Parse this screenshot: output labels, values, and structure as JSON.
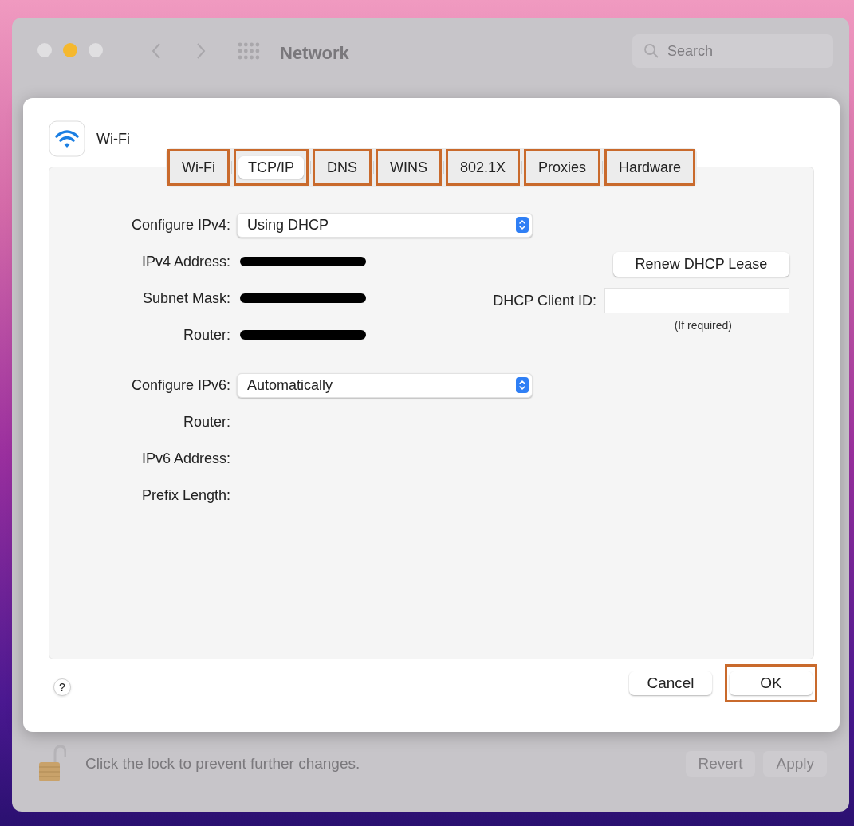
{
  "window": {
    "title": "Network",
    "search": {
      "placeholder": "Search"
    }
  },
  "sheet": {
    "title": "Wi-Fi",
    "tabs": [
      {
        "label": "Wi-Fi",
        "selected": false,
        "highlighted": true
      },
      {
        "label": "TCP/IP",
        "selected": true,
        "highlighted": true
      },
      {
        "label": "DNS",
        "selected": false,
        "highlighted": true
      },
      {
        "label": "WINS",
        "selected": false,
        "highlighted": true
      },
      {
        "label": "802.1X",
        "selected": false,
        "highlighted": true
      },
      {
        "label": "Proxies",
        "selected": false,
        "highlighted": true
      },
      {
        "label": "Hardware",
        "selected": false,
        "highlighted": true
      }
    ],
    "ipv4": {
      "label": "Configure IPv4:",
      "value": "Using DHCP"
    },
    "ipv4_fields": [
      {
        "label": "IPv4 Address:",
        "redacted": true
      },
      {
        "label": "Subnet Mask:",
        "redacted": true
      },
      {
        "label": "Router:",
        "redacted": true
      }
    ],
    "renew_button": "Renew DHCP Lease",
    "client_id": {
      "label": "DHCP Client ID:",
      "hint": "(If required)"
    },
    "ipv6": {
      "label": "Configure IPv6:",
      "value": "Automatically"
    },
    "ipv6_fields": [
      {
        "label": "Router:",
        "redacted": false
      },
      {
        "label": "IPv6 Address:",
        "redacted": false
      },
      {
        "label": "Prefix Length:",
        "redacted": false
      }
    ],
    "help": "?",
    "buttons": [
      {
        "label": "Cancel",
        "highlighted": false
      },
      {
        "label": "OK",
        "highlighted": true
      }
    ]
  },
  "footer": {
    "lock_text": "Click the lock to prevent further changes.",
    "buttons": [
      {
        "label": "Revert",
        "disabled": true
      },
      {
        "label": "Apply",
        "disabled": true
      }
    ]
  }
}
